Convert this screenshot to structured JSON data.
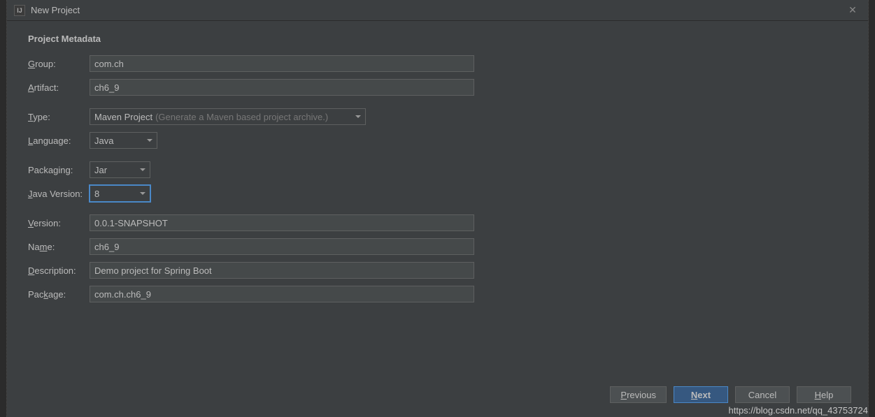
{
  "window": {
    "title": "New Project",
    "icon_label": "IJ"
  },
  "section_title": "Project Metadata",
  "labels": {
    "group": "Group:",
    "artifact": "Artifact:",
    "type": "Type:",
    "language": "Language:",
    "packaging": "Packaging:",
    "java_version": "Java Version:",
    "version": "Version:",
    "name": "Name:",
    "description": "Description:",
    "package": "Package:"
  },
  "underlines": {
    "group": "G",
    "artifact": "A",
    "type": "T",
    "language": "L",
    "java_version": "J",
    "version": "V",
    "name": "m",
    "description": "D",
    "package": "k"
  },
  "values": {
    "group": "com.ch",
    "artifact": "ch6_9",
    "type": "Maven Project",
    "type_hint": "(Generate a Maven based project archive.)",
    "language": "Java",
    "packaging": "Jar",
    "java_version": "8",
    "version": "0.0.1-SNAPSHOT",
    "name": "ch6_9",
    "description": "Demo project for Spring Boot",
    "package": "com.ch.ch6_9"
  },
  "buttons": {
    "previous": "Previous",
    "next": "Next",
    "cancel": "Cancel",
    "help": "Help"
  },
  "watermark": "https://blog.csdn.net/qq_43753724"
}
